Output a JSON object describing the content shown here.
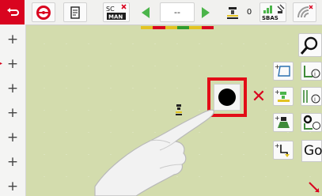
{
  "toolbar": {
    "sc_label": "SC",
    "man_label": "MAN",
    "value": "--",
    "count": "0",
    "sbas_label": "SBAS"
  },
  "tiltbar": {
    "colors": [
      "#e3c322",
      "#d9041f",
      "#e3c322",
      "#2f9b2c",
      "#e3c322",
      "#d9041f"
    ]
  },
  "right_tools": {
    "go_label": "Go"
  },
  "icons": {
    "back": "back-arrow-icon",
    "steering": "steering-wheel-icon",
    "document": "document-icon",
    "sc_man": "section-control-manual-icon",
    "prev": "arrow-left-icon",
    "next": "arrow-right-icon",
    "implement": "implement-icon",
    "sbas": "gps-signal-icon",
    "wifi": "wifi-icon",
    "record": "record-icon",
    "cancel": "close-icon",
    "search": "magnifier-icon"
  },
  "colors": {
    "accent_red": "#d9041f",
    "map_bg": "#d3dcad",
    "arrow_green": "#4bb54a"
  }
}
